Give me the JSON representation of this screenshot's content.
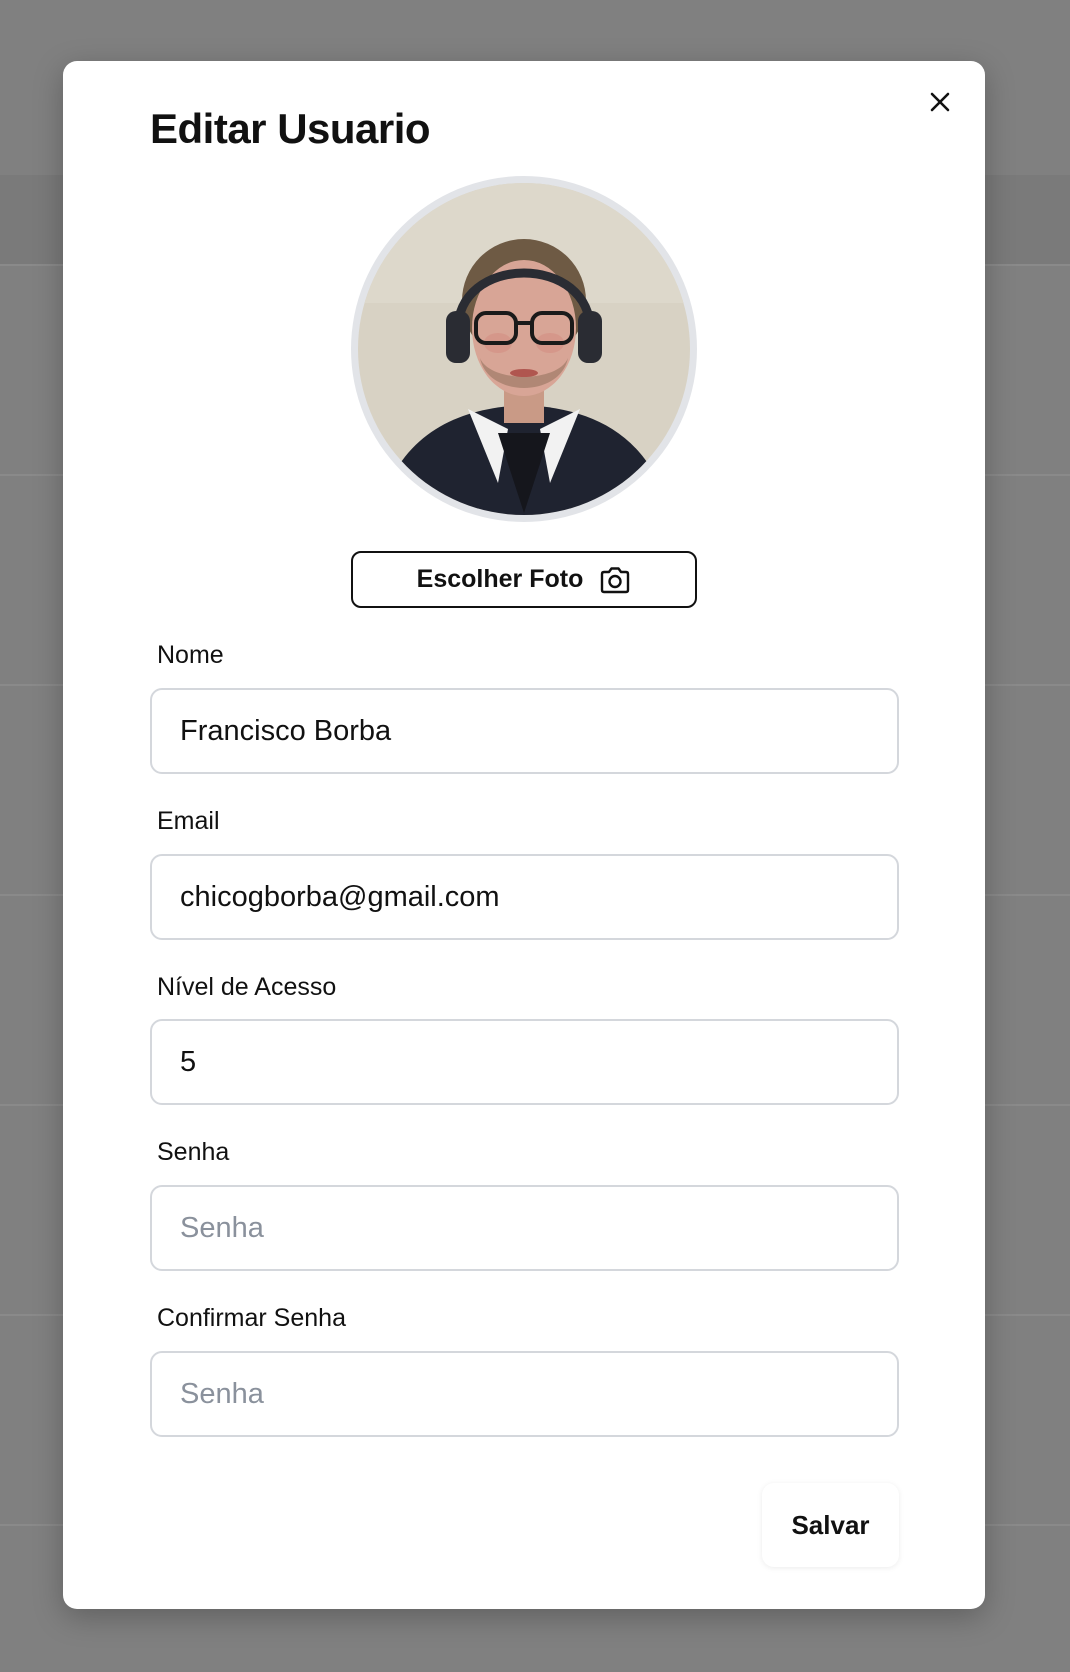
{
  "modal": {
    "title": "Editar Usuario",
    "close_icon": "close-icon",
    "choose_photo_label": "Escolher Foto",
    "camera_icon": "camera-icon",
    "save_label": "Salvar"
  },
  "form": {
    "name": {
      "label": "Nome",
      "value": "Francisco Borba"
    },
    "email": {
      "label": "Email",
      "value": "chicogborba@gmail.com"
    },
    "access_level": {
      "label": "Nível de Acesso",
      "value": "5"
    },
    "password": {
      "label": "Senha",
      "placeholder": "Senha"
    },
    "confirm_password": {
      "label": "Confirmar Senha",
      "placeholder": "Senha"
    }
  },
  "colors": {
    "overlay": "#808080",
    "modal_bg": "#ffffff",
    "input_border": "#d4d7dc",
    "placeholder": "#8a919c",
    "text": "#111111"
  }
}
